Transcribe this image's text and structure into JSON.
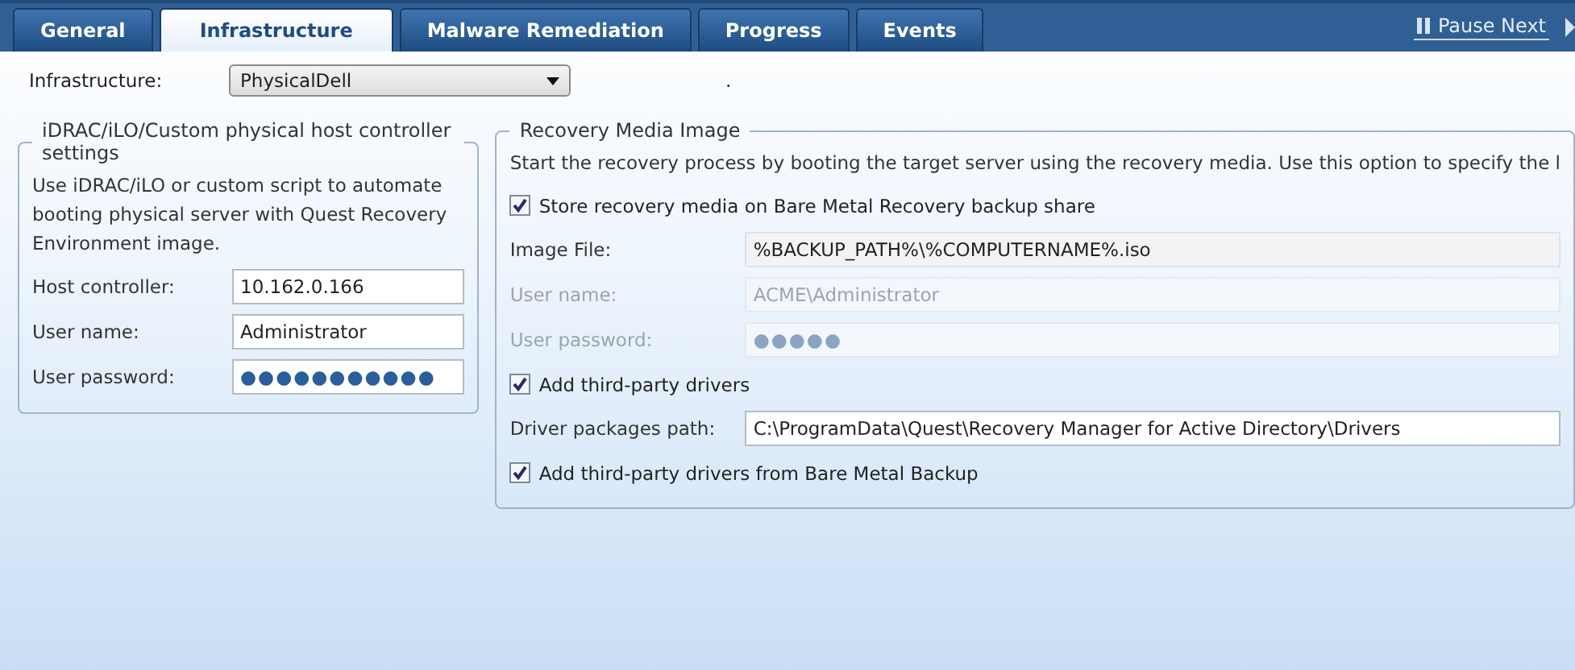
{
  "tabs": [
    {
      "label": "General",
      "selected": false
    },
    {
      "label": "Infrastructure",
      "selected": true
    },
    {
      "label": "Malware Remediation",
      "selected": false
    },
    {
      "label": "Progress",
      "selected": false
    },
    {
      "label": "Events",
      "selected": false
    }
  ],
  "toolbar": {
    "pause_next": "Pause Next"
  },
  "infrastructure": {
    "label": "Infrastructure:",
    "value": "PhysicalDell",
    "mark": "."
  },
  "host_controller_group": {
    "title": "iDRAC/iLO/Custom physical host controller settings",
    "description": "Use iDRAC/iLO or custom script to automate booting physical server with Quest Recovery Environment image.",
    "fields": [
      {
        "label": "Host controller:",
        "value": "10.162.0.166",
        "disabled": false,
        "readonly": false
      },
      {
        "label": "User name:",
        "value": "Administrator",
        "disabled": false,
        "readonly": false
      },
      {
        "label": "User password:",
        "value": "●●●●●●●●●●●",
        "disabled": false,
        "readonly": false
      }
    ]
  },
  "recovery_media_group": {
    "title": "Recovery Media Image",
    "description": "Start the recovery process by booting the target server using the recovery media. Use this option to specify the l",
    "items": [
      {
        "kind": "checkbox",
        "label": "Store recovery media on Bare Metal Recovery backup share",
        "checked": true
      },
      {
        "kind": "field",
        "label": "Image File:",
        "value": "%BACKUP_PATH%\\%COMPUTERNAME%.iso",
        "disabled": false,
        "readonly": true
      },
      {
        "kind": "field",
        "label": "User name:",
        "value": "ACME\\Administrator",
        "disabled": true,
        "readonly": false
      },
      {
        "kind": "field",
        "label": "User password:",
        "value": "●●●●●",
        "disabled": true,
        "readonly": false
      },
      {
        "kind": "checkbox",
        "label": "Add third-party drivers",
        "checked": true
      },
      {
        "kind": "field",
        "label": "Driver packages path:",
        "value": "C:\\ProgramData\\Quest\\Recovery Manager for Active Directory\\Drivers",
        "disabled": false,
        "readonly": false
      },
      {
        "kind": "checkbox",
        "label": "Add third-party drivers from Bare Metal Backup",
        "checked": true
      }
    ]
  }
}
